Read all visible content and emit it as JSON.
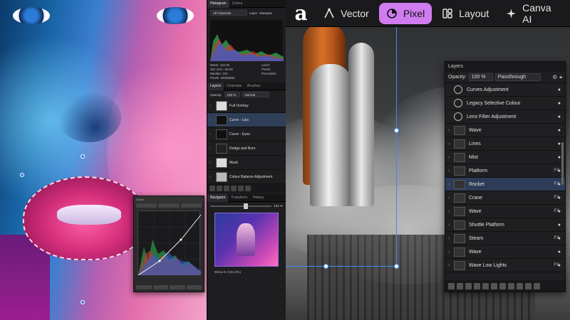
{
  "toolbar": {
    "logo_glyph": "a",
    "personas": [
      {
        "label": "Vector",
        "icon": "vector-persona-icon",
        "active": false
      },
      {
        "label": "Pixel",
        "icon": "pixel-persona-icon",
        "active": true
      },
      {
        "label": "Layout",
        "icon": "layout-persona-icon",
        "active": false
      },
      {
        "label": "Canva AI",
        "icon": "sparkle-icon",
        "active": false
      }
    ],
    "accent": "#d07cf0"
  },
  "mid_panel": {
    "top_tabs": [
      "Histogram",
      "Colour"
    ],
    "channel_select": "All Channels",
    "histogram_options": [
      "Layer",
      "Marquee"
    ],
    "stats": [
      "Mean: 110.26",
      "Std. Dev.: 65.90",
      "Median: 102",
      "Pixels: 28305684"
    ],
    "stats_right": [
      "Level:",
      "Pixels:",
      "Percentile:"
    ],
    "layer_tabs": [
      "Layers",
      "Channels",
      "Brushes"
    ],
    "opacity_label": "Opacity:",
    "opacity_value": "100 %",
    "blend_mode": "Normal",
    "layers": [
      {
        "name": "Full Overlay",
        "selected": false
      },
      {
        "name": "Curve - Lips",
        "selected": true
      },
      {
        "name": "Curve - Eyes",
        "selected": false
      },
      {
        "name": "Dodge and Burn",
        "selected": false
      },
      {
        "name": "Mask",
        "selected": false
      },
      {
        "name": "Colour Balance Adjustment",
        "selected": false
      }
    ],
    "nav_tabs": [
      "Navigator",
      "Transform",
      "History"
    ],
    "zoom_value": "102 %",
    "nav_caption": "Elena-IU (102.0%)"
  },
  "curves_dialog": {
    "title": "Curve"
  },
  "layers_panel": {
    "title": "Layers",
    "opacity_label": "Opacity:",
    "opacity_value": "100 %",
    "blend_mode": "Passthrough",
    "rows": [
      {
        "name": "Curves Adjustment",
        "fx": false,
        "highlighted": false
      },
      {
        "name": "Legacy Selective Colour",
        "fx": false,
        "highlighted": false
      },
      {
        "name": "Lens Filter Adjustment",
        "fx": false,
        "highlighted": false
      },
      {
        "name": "Wave",
        "fx": false,
        "highlighted": false
      },
      {
        "name": "Lines",
        "fx": false,
        "highlighted": false
      },
      {
        "name": "Mist",
        "fx": false,
        "highlighted": false
      },
      {
        "name": "Platform",
        "fx": true,
        "highlighted": false
      },
      {
        "name": "Rocket",
        "fx": true,
        "highlighted": true
      },
      {
        "name": "Crane",
        "fx": true,
        "highlighted": false
      },
      {
        "name": "Wave",
        "fx": true,
        "highlighted": false
      },
      {
        "name": "Shuttle Platform",
        "fx": false,
        "highlighted": false
      },
      {
        "name": "Steam",
        "fx": true,
        "highlighted": false
      },
      {
        "name": "Wave",
        "fx": false,
        "highlighted": false
      },
      {
        "name": "Wave Low Lights",
        "fx": true,
        "highlighted": false
      }
    ],
    "fx_label": "FX"
  }
}
